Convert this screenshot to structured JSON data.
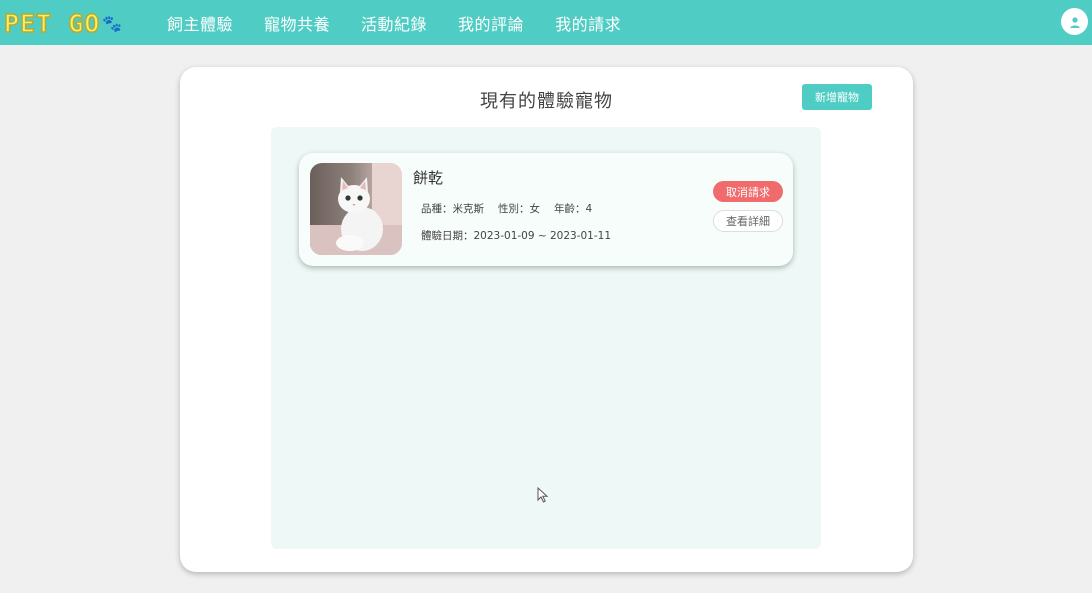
{
  "nav": {
    "logo": "PET GO",
    "links": [
      "飼主體驗",
      "寵物共養",
      "活動紀錄",
      "我的評論",
      "我的請求"
    ]
  },
  "main": {
    "title": "現有的體驗寵物",
    "add_button": "新增寵物"
  },
  "pets": [
    {
      "name": "餅乾",
      "breed": "品種：米克斯",
      "gender": "性別：女",
      "age": "年齡：4",
      "date": "體驗日期：2023-01-09 ~ 2023-01-11",
      "cancel_label": "取消請求",
      "detail_label": "查看詳細"
    }
  ],
  "colors": {
    "brand": "#4fcdc4",
    "cancel": "#f06b6b",
    "list_bg": "#eef8f6"
  }
}
